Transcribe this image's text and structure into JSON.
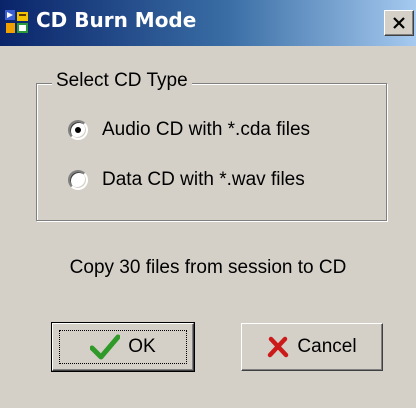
{
  "window": {
    "title": "CD Burn Mode",
    "app_icon": "cd-burn-app-icon",
    "close_icon": "close-icon"
  },
  "groupbox": {
    "legend": "Select CD Type",
    "options": [
      {
        "label": "Audio CD with *.cda files",
        "selected": true
      },
      {
        "label": "Data CD with *.wav files",
        "selected": false
      }
    ]
  },
  "info_text": "Copy 30 files from session to CD",
  "buttons": {
    "ok": {
      "label": "OK",
      "icon": "checkmark-icon"
    },
    "cancel": {
      "label": "Cancel",
      "icon": "red-x-icon"
    }
  },
  "colors": {
    "titlebar_start": "#0a246a",
    "titlebar_end": "#a6caf0",
    "face": "#d4d0c8",
    "check_green": "#2f9a2a",
    "cancel_red": "#cc1a1a"
  }
}
